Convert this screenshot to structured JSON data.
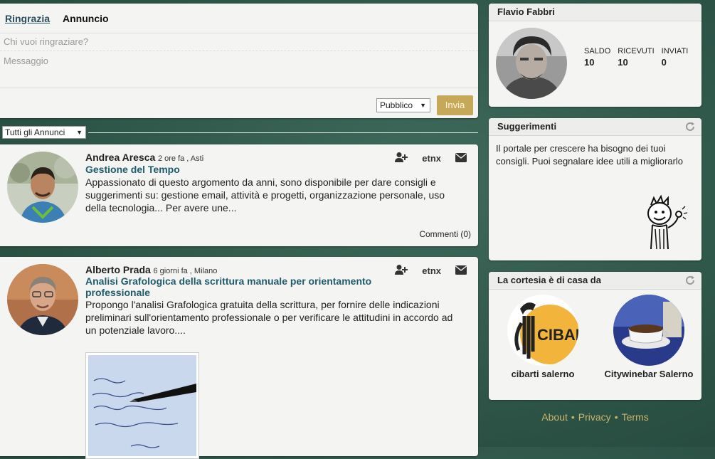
{
  "composer": {
    "tabs": [
      "Ringrazia",
      "Annuncio"
    ],
    "recipient_placeholder": "Chi vuoi ringraziare?",
    "message_placeholder": "Messaggio",
    "visibility": "Pubblico",
    "send_label": "Invia"
  },
  "filter": {
    "selected": "Tutti gli Annunci"
  },
  "posts": [
    {
      "author": "Andrea Aresca",
      "meta": "2 ore fa , Asti",
      "title": "Gestione del Tempo",
      "body": "Appassionato di questo argomento da anni, sono disponibile per dare consigli e suggerimenti su: gestione email, attività e progetti, organizzazione personale, uso della tecnologia... Per avere une...",
      "etnx": "etnx",
      "comments": "Commenti (0)"
    },
    {
      "author": "Alberto Prada",
      "meta": "6 giorni fa , Milano",
      "title": "Analisi Grafologica della scrittura manuale per orientamento professionale",
      "body": "Propongo l'analisi Grafologica gratuita della scrittura, per fornire delle indicazioni preliminari sull'orientamento professionale o per verificare le attitudini in accordo ad un potenziale lavoro....",
      "etnx": "etnx"
    }
  ],
  "profile": {
    "name": "Flavio Fabbri",
    "stats": [
      {
        "label": "SALDO",
        "value": "10"
      },
      {
        "label": "RICEVUTI",
        "value": "10"
      },
      {
        "label": "INVIATI",
        "value": "0"
      }
    ]
  },
  "suggestions": {
    "title": "Suggerimenti",
    "text": "Il portale per crescere ha bisogno dei tuoi consigli. Puoi segnalare idee utili a migliorarlo"
  },
  "courtesy": {
    "title": "La cortesia è di casa da",
    "businesses": [
      {
        "name": "cibarti salerno",
        "logo_text": "CIBAR"
      },
      {
        "name": "Citywinebar Salerno"
      }
    ]
  },
  "footer": {
    "links": [
      "About",
      "Privacy",
      "Terms"
    ]
  }
}
